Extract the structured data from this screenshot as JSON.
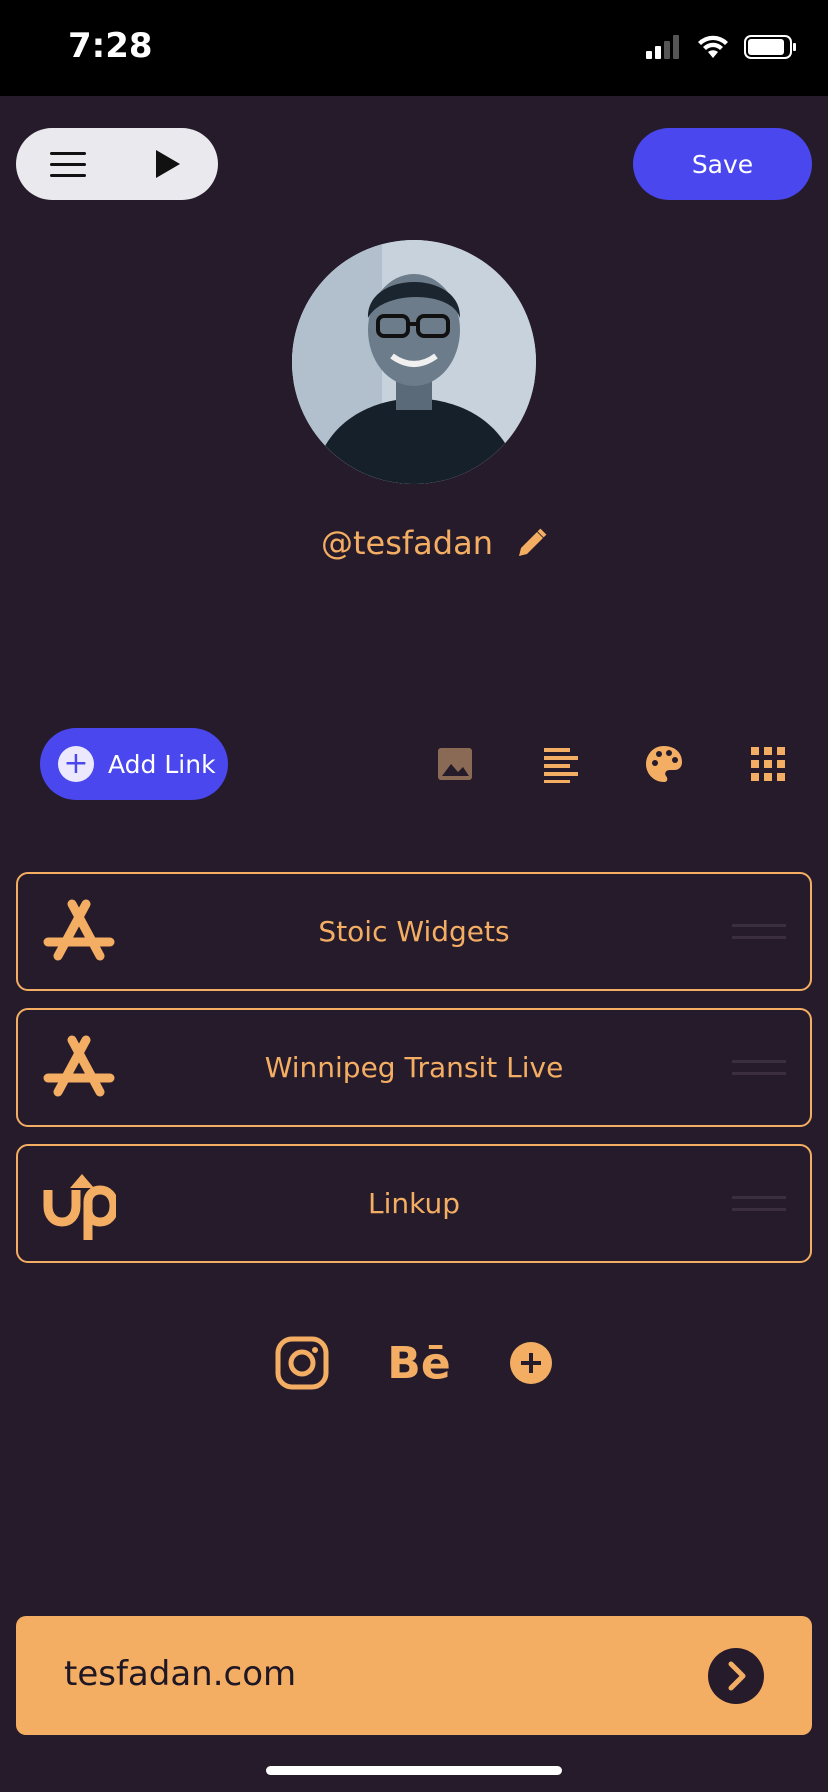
{
  "status_bar": {
    "time": "7:28"
  },
  "header": {
    "save_label": "Save"
  },
  "profile": {
    "username": "@tesfadan"
  },
  "toolbar": {
    "add_link_label": "Add Link"
  },
  "links": [
    {
      "title": "Stoic Widgets",
      "icon": "app-store-icon"
    },
    {
      "title": "Winnipeg Transit Live",
      "icon": "app-store-icon"
    },
    {
      "title": "Linkup",
      "icon": "upwork-icon"
    }
  ],
  "social": {
    "behance_label": "Bē"
  },
  "footer": {
    "domain": "tesfadan.com"
  },
  "colors": {
    "background": "#261b2b",
    "accent": "#f4ae63",
    "primary": "#4a47ee"
  }
}
